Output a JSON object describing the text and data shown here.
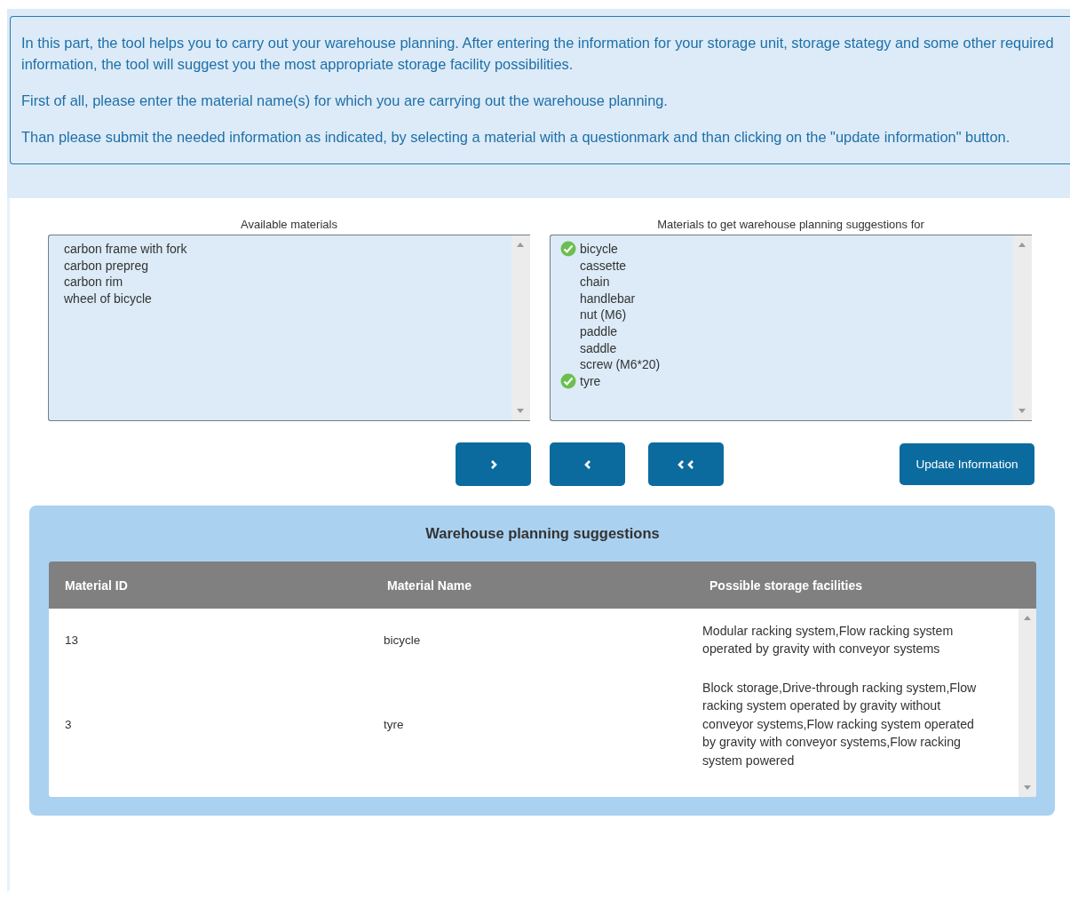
{
  "intro": {
    "paragraphs": [
      "In this part, the tool helps you to carry out your warehouse planning. After entering the information for your storage unit, storage stategy and some other required information, the tool will suggest you the most appropriate storage facility possibilities.",
      "First of all, please enter the material name(s) for which you are carrying out the warehouse planning.",
      "Than please submit the needed information as indicated, by selecting a material with a questionmark and than clicking on the \"update information\" button."
    ]
  },
  "available_materials": {
    "title": "Available materials",
    "items": [
      "carbon frame with fork",
      "carbon prepreg",
      "carbon rim",
      "wheel of bicycle"
    ]
  },
  "selected_materials": {
    "title": "Materials to get warehouse planning suggestions for",
    "items": [
      {
        "label": "bicycle",
        "checked": true
      },
      {
        "label": "cassette",
        "checked": false
      },
      {
        "label": "chain",
        "checked": false
      },
      {
        "label": "handlebar",
        "checked": false
      },
      {
        "label": "nut (M6)",
        "checked": false
      },
      {
        "label": "paddle",
        "checked": false
      },
      {
        "label": "saddle",
        "checked": false
      },
      {
        "label": "screw (M6*20)",
        "checked": false
      },
      {
        "label": "tyre",
        "checked": true
      }
    ]
  },
  "buttons": [
    {
      "kind": "add"
    },
    {
      "kind": "remove"
    },
    {
      "kind": "remove_all"
    }
  ],
  "update_button": "Update Information",
  "suggestions": {
    "title": "Warehouse planning suggestions",
    "columns": [
      "Material ID",
      "Material Name",
      "Possible storage facilities"
    ],
    "rows": [
      [
        "13",
        "bicycle",
        "Modular racking system,Flow racking system operated by gravity with conveyor systems"
      ],
      [
        "3",
        "tyre",
        "Block storage,Drive-through racking system,Flow racking system operated by gravity without conveyor systems,Flow racking system operated by gravity with conveyor systems,Flow racking system powered"
      ]
    ]
  }
}
